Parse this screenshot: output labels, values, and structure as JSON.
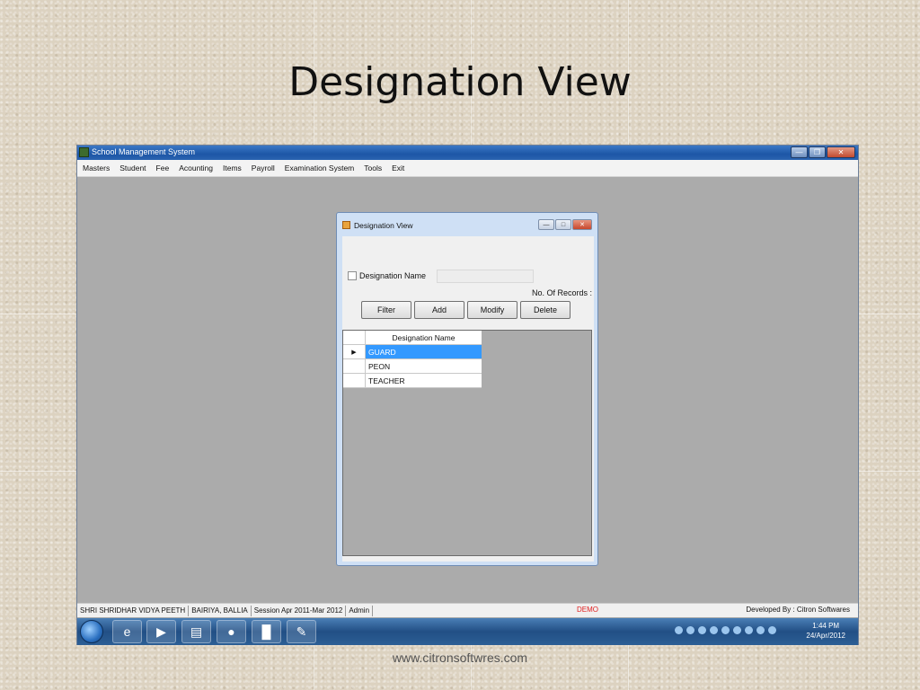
{
  "slide": {
    "title": "Designation View",
    "footer": "www.citronsoftwres.com"
  },
  "window": {
    "title": "School Management System",
    "menu": [
      "Masters",
      "Student",
      "Fee",
      "Acounting",
      "Items",
      "Payroll",
      "Examination System",
      "Tools",
      "Exit"
    ]
  },
  "dialog": {
    "title": "Designation View",
    "checkbox_label": "Designation Name",
    "records_label": "No. Of Records :",
    "buttons": {
      "filter": "Filter",
      "add": "Add",
      "modify": "Modify",
      "delete": "Delete"
    },
    "grid": {
      "column": "Designation Name",
      "rows": [
        "GUARD",
        "PEON",
        "TEACHER"
      ],
      "selected_row": 0
    }
  },
  "status": {
    "school": "SHRI SHRIDHAR VIDYA PEETH",
    "place": "BAIRIYA, BALLIA",
    "session": "Session Apr 2011-Mar 2012",
    "user": "Admin",
    "mode": "DEMO",
    "developer": "Developed By : Citron Softwares"
  },
  "taskbar": {
    "time": "1:44 PM",
    "date": "24/Apr/2012"
  },
  "colors": {
    "selection": "#3399ff",
    "demo_text": "#e02020",
    "mdi_background": "#ababab"
  }
}
